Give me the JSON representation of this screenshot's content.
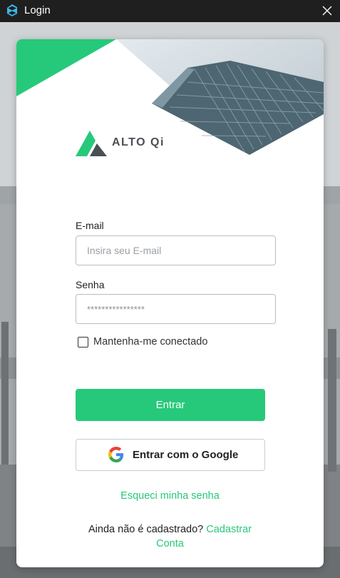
{
  "window": {
    "title": "Login",
    "app_icon": "altoqi-app-icon",
    "close_icon": "close-icon"
  },
  "brand": {
    "name": "ALTO Qi",
    "accent_color": "#26c97a"
  },
  "form": {
    "email_label": "E-mail",
    "email_placeholder": "Insira seu E-mail",
    "email_value": "",
    "password_label": "Senha",
    "password_value": "****************",
    "remember_label": "Mantenha-me conectado",
    "remember_checked": false,
    "login_button": "Entrar",
    "google_button": "Entrar com o Google",
    "forgot_password": "Esqueci minha senha",
    "signup_prompt": "Ainda não é cadastrado?",
    "signup_link_part1": "Cadastrar",
    "signup_link_part2": "Conta"
  }
}
